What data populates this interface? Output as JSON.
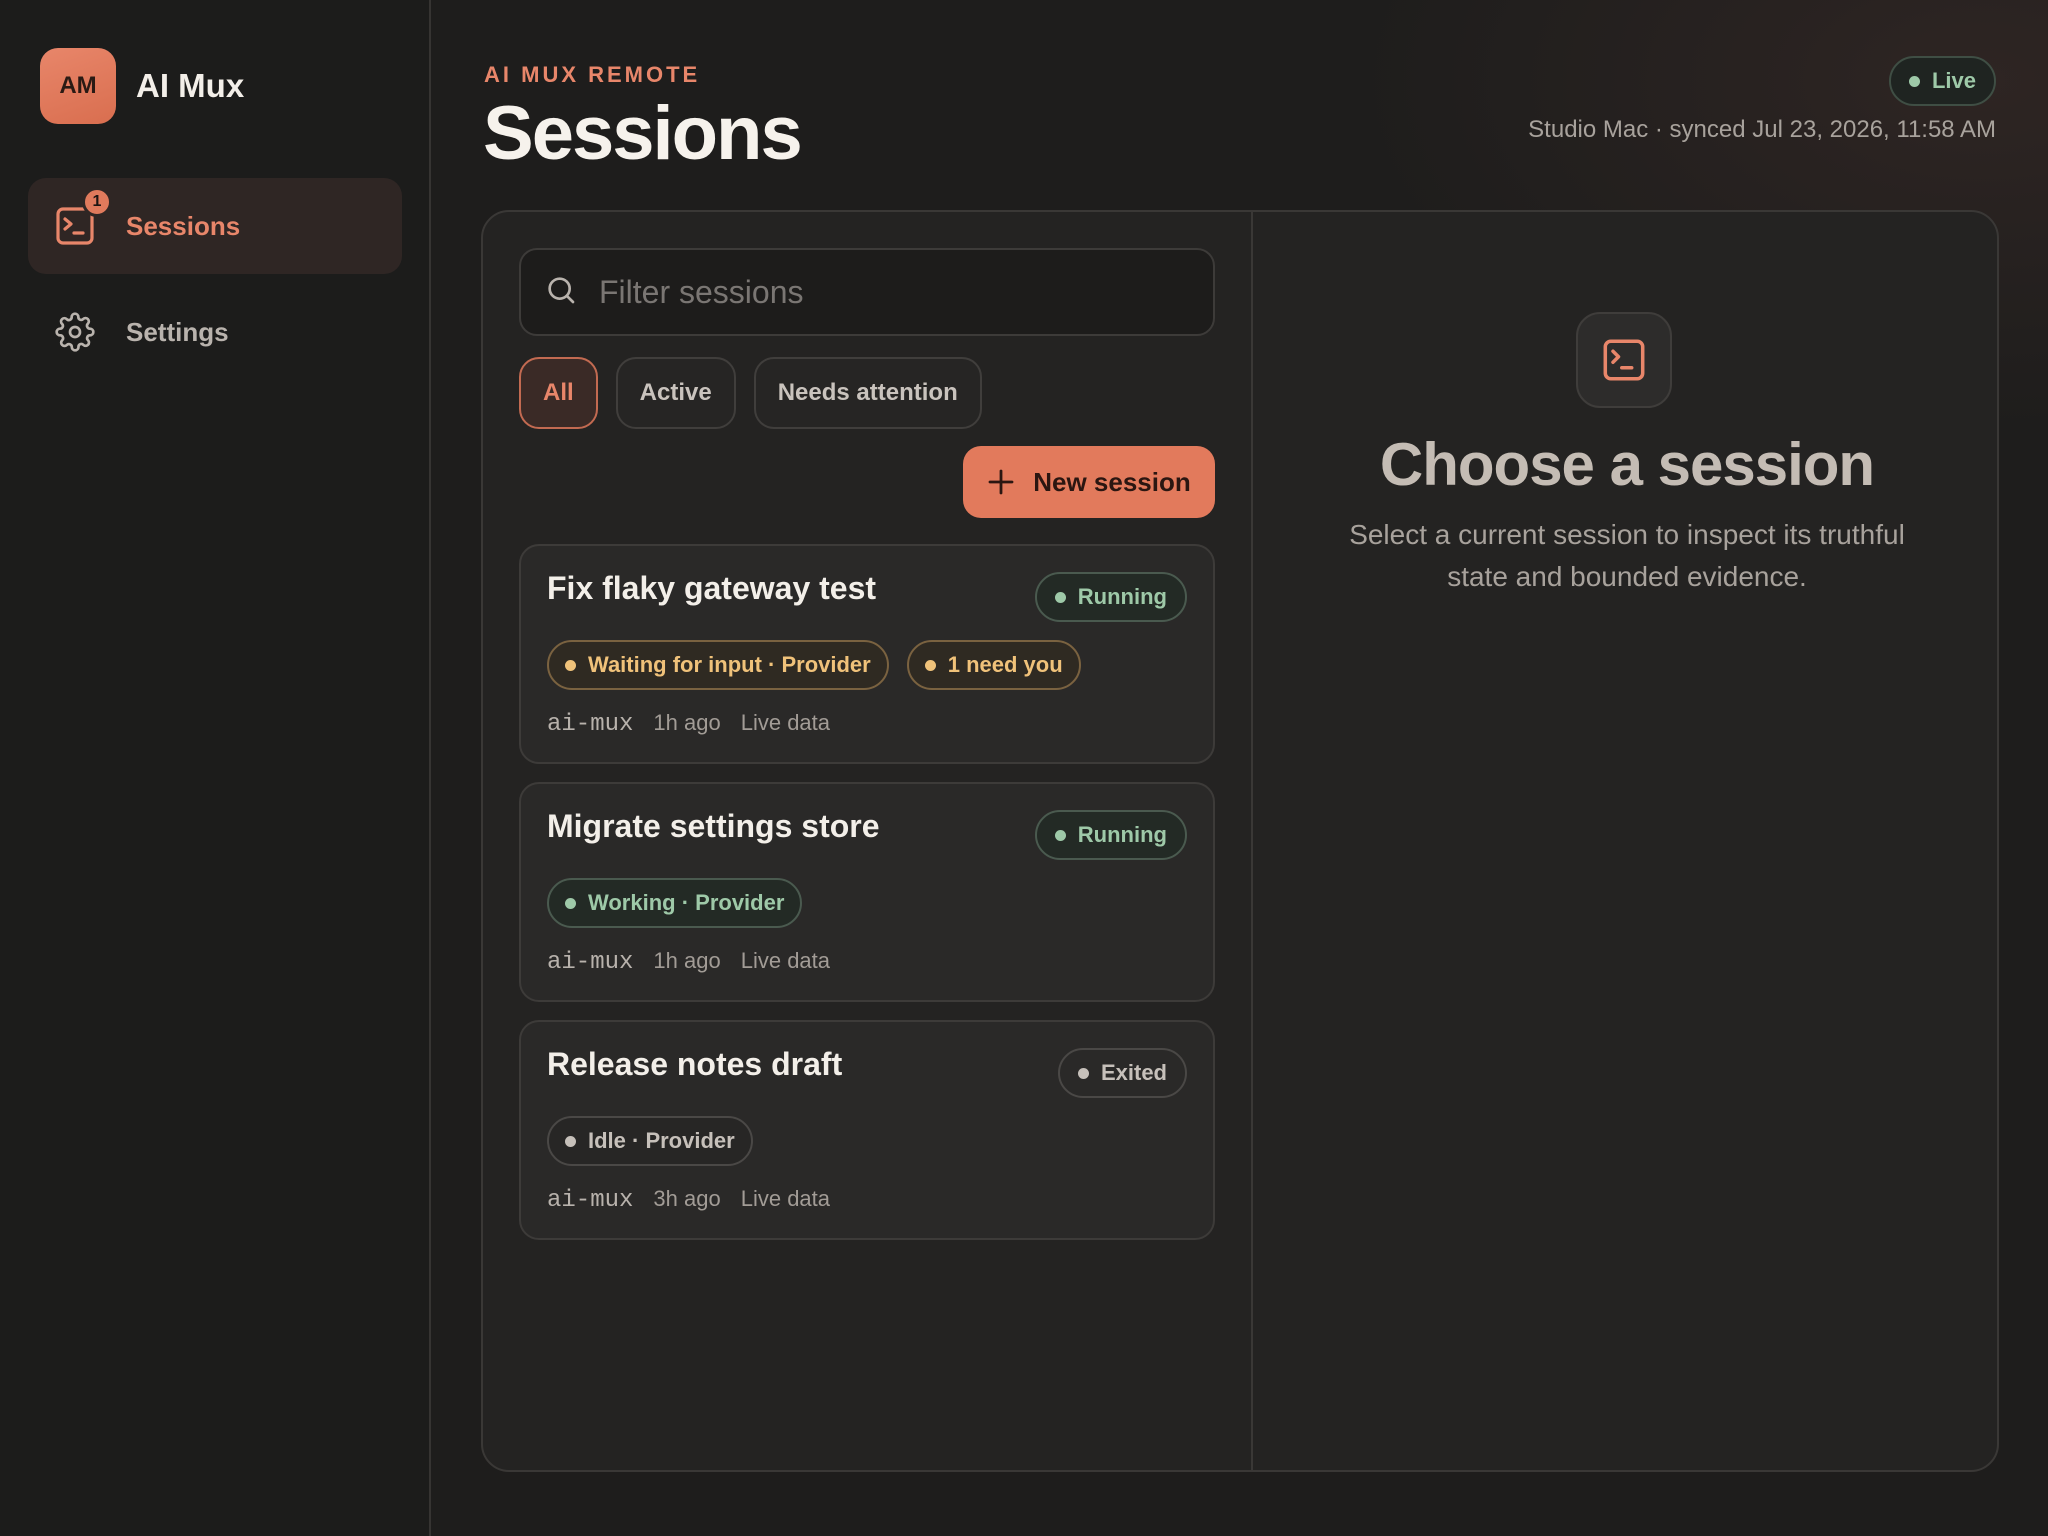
{
  "brand": {
    "initials": "AM",
    "name": "AI Mux"
  },
  "nav": {
    "sessions": {
      "label": "Sessions",
      "badge": "1"
    },
    "settings": {
      "label": "Settings"
    }
  },
  "header": {
    "eyebrow": "AI MUX REMOTE",
    "title": "Sessions",
    "live_label": "Live",
    "sync_text": "Studio Mac · synced Jul 23, 2026, 11:58 AM"
  },
  "search": {
    "placeholder": "Filter sessions",
    "value": ""
  },
  "filters": [
    {
      "label": "All",
      "selected": true
    },
    {
      "label": "Active",
      "selected": false
    },
    {
      "label": "Needs attention",
      "selected": false
    }
  ],
  "new_session_label": "New session",
  "sessions": [
    {
      "title": "Fix flaky gateway test",
      "status": "Running",
      "tags": [
        "Waiting for input · Provider",
        "1 need you"
      ],
      "workspace": "ai-mux",
      "age": "1h ago",
      "source": "Live data"
    },
    {
      "title": "Migrate settings store",
      "status": "Running",
      "tags": [
        "Working · Provider"
      ],
      "workspace": "ai-mux",
      "age": "1h ago",
      "source": "Live data"
    },
    {
      "title": "Release notes draft",
      "status": "Exited",
      "tags": [
        "Idle · Provider"
      ],
      "workspace": "ai-mux",
      "age": "3h ago",
      "source": "Live data"
    }
  ],
  "empty_state": {
    "title": "Choose a session",
    "description": "Select a current session to inspect its truthful state and bounded evidence."
  },
  "colors": {
    "accent": "#e27a5c",
    "running": "#9ec9a8",
    "warning": "#f0c27a",
    "neutral": "#c6c0ba"
  }
}
